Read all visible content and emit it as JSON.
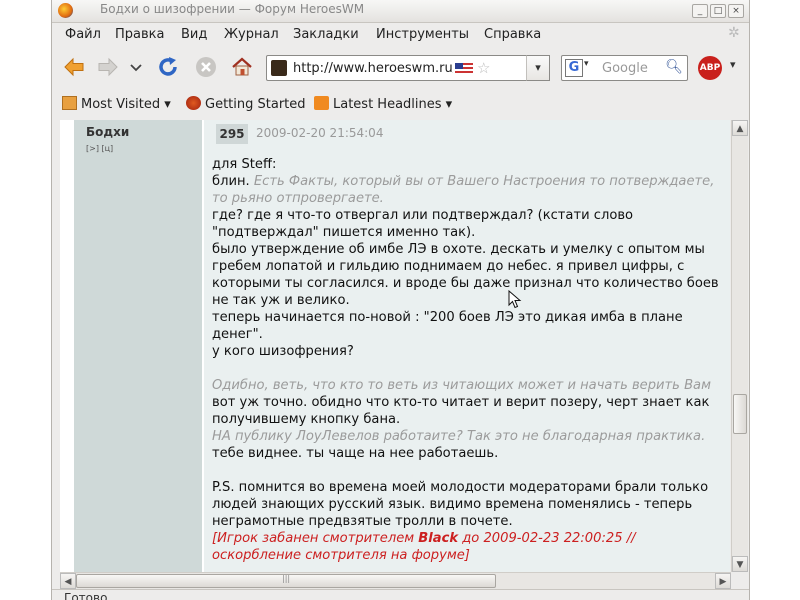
{
  "window": {
    "title": "Бодхи о шизофрении — Форум HeroesWM",
    "buttons": [
      "_",
      "□",
      "×"
    ]
  },
  "menu": [
    "Файл",
    "Правка",
    "Вид",
    "Журнал",
    "Закладки",
    "Инструменты",
    "Справка"
  ],
  "toolbar": {
    "url": "http://www.heroeswm.ru/forum",
    "search_placeholder": "Google",
    "abp_label": "ABP"
  },
  "bookmarks": [
    {
      "label": "Most Visited",
      "icon": "folder-icon",
      "dropdown": true
    },
    {
      "label": "Getting Started",
      "icon": "firefox-icon",
      "dropdown": false
    },
    {
      "label": "Latest Headlines",
      "icon": "rss-icon",
      "dropdown": true
    }
  ],
  "post": {
    "author": "Бодхи",
    "author_links": "[>] [ц]",
    "number": "295",
    "datetime": "2009-02-20 21:54:04",
    "lines": [
      {
        "type": "text",
        "text": "для Steff:"
      },
      {
        "type": "text",
        "text": "блин. ",
        "quote": "Есть Факты, который вы от Вашего Настроения то потверждаете,"
      },
      {
        "type": "quote",
        "text": "то рьяно отпровергаете."
      },
      {
        "type": "text",
        "text": "где? где я что-то отвергал или подтверждал? (кстати слово"
      },
      {
        "type": "text",
        "text": "\"подтверждал\" пишется именно так)."
      },
      {
        "type": "text",
        "text": "было утверждение об имбе ЛЭ в охоте. дескать и умелку с опытом мы"
      },
      {
        "type": "text",
        "text": "гребем лопатой и гильдию поднимаем до небес. я привел цифры, с"
      },
      {
        "type": "text",
        "text": "которыми ты согласился. и вроде бы даже признал что количество боев"
      },
      {
        "type": "text",
        "text": "не так уж и велико."
      },
      {
        "type": "text",
        "text": "теперь начинается по-новой : \"200 боев ЛЭ это дикая имба в плане"
      },
      {
        "type": "text",
        "text": "денег\"."
      },
      {
        "type": "text",
        "text": "у кого шизофрения?"
      },
      {
        "type": "gap",
        "text": ""
      },
      {
        "type": "quote",
        "text": "Одибно, веть, что кто то веть из читающих может и начать верить Вам"
      },
      {
        "type": "text",
        "text": "вот уж точно. обидно что кто-то читает и верит позеру, черт знает как"
      },
      {
        "type": "text",
        "text": "получившему кнопку бана."
      },
      {
        "type": "quote",
        "text": "НА публику ЛоуЛевелов работаите? Так это не благодарная практика."
      },
      {
        "type": "text",
        "text": "тебе виднее. ты чаще на нее работаешь."
      },
      {
        "type": "gap",
        "text": ""
      },
      {
        "type": "text",
        "text": "P.S. помнится во времена моей молодости модераторами брали только"
      },
      {
        "type": "text",
        "text": "людей знающих русский язык. видимо времена поменялись - теперь"
      },
      {
        "type": "text",
        "text": "неграмотные предвзятые тролли в почете."
      }
    ],
    "moderator_note": {
      "prefix": "[Игрок забанен смотрителем ",
      "moderator": "Black",
      "suffix": " до 2009-02-23 22:00:25 //",
      "line2": "оскорбление смотрителя на форуме]"
    }
  },
  "status": "Готово",
  "colors": {
    "author_column": "#cfd9d8",
    "post_column": "#eaf0f0",
    "quote": "#9b9b9b",
    "moderator_note": "#cc2020"
  }
}
